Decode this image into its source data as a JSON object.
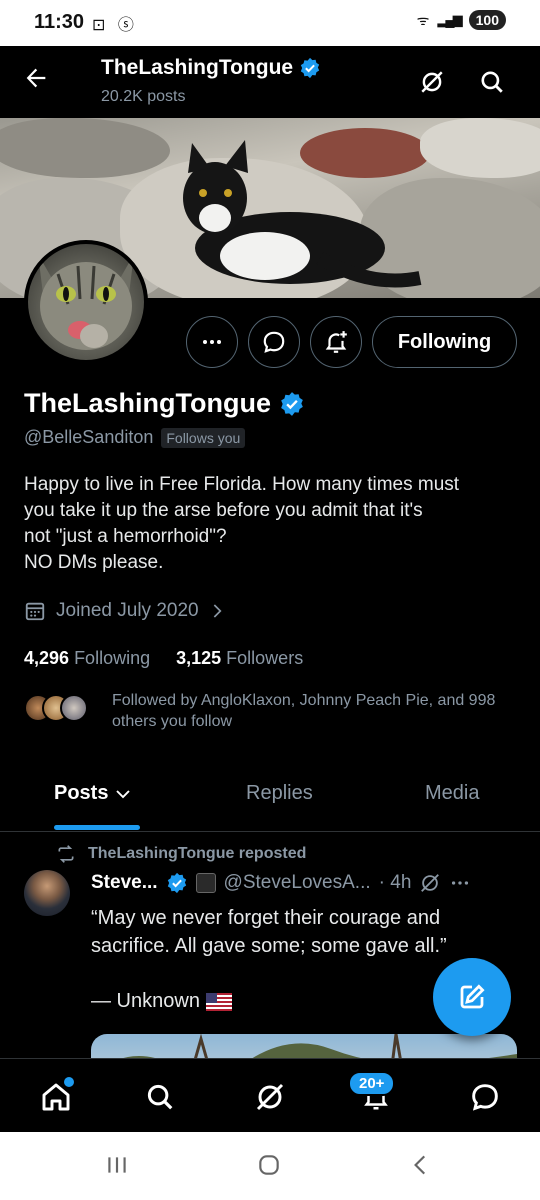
{
  "status_bar": {
    "time": "11:30",
    "notification_icons": "⊡ ⓢ",
    "wifi": "ᯤ",
    "signal": "▂▄▆",
    "battery": "100"
  },
  "header": {
    "title": "TheLashingTongue",
    "posts_count": "20.2K posts"
  },
  "profile": {
    "name": "TheLashingTongue",
    "handle": "@BelleSanditon",
    "follows_you": "Follows you",
    "bio_lines": [
      "Happy to live in Free Florida. How many times must",
      "you take it up the arse before you admit that it's",
      "not \"just a hemorrhoid\"?",
      "NO DMs please."
    ],
    "joined": "Joined July 2020",
    "following_count": "4,296",
    "following_label": "Following",
    "followers_count": "3,125",
    "followers_label": "Followers",
    "followed_by": "Followed by AngloKlaxon, Johnny Peach Pie, and 998 others you follow",
    "follow_button": "Following"
  },
  "tabs": [
    {
      "label": "Posts"
    },
    {
      "label": "Replies"
    },
    {
      "label": "Media"
    }
  ],
  "post": {
    "repost_label": "TheLashingTongue reposted",
    "author_name": "Steve...",
    "author_handle": "@SteveLovesA...",
    "time": "· 4h",
    "text": "“May we never forget their courage and sacrifice. All gave some; some gave all.”",
    "attribution": "— Unknown"
  },
  "bottom_nav": {
    "notifications_badge": "20+"
  },
  "colors": {
    "accent": "#1d9bf0",
    "background": "#000000",
    "secondary_text": "#8b98a5"
  }
}
